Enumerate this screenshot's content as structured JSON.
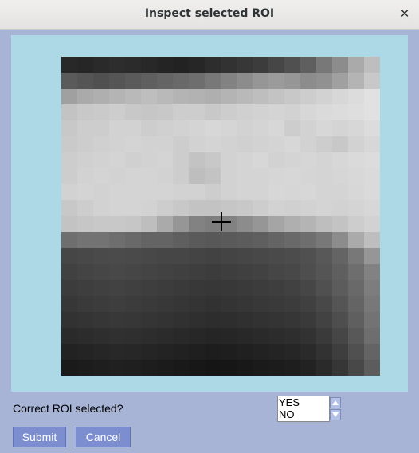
{
  "window": {
    "title": "Inspect selected ROI"
  },
  "close_icon": "close-icon",
  "question": "Correct ROI selected?",
  "options": [
    "YES",
    "NO"
  ],
  "buttons": {
    "submit": "Submit",
    "cancel": "Cancel"
  },
  "colors": {
    "window_bg": "#a7b4d6",
    "panel_bg": "#add8e6",
    "button_bg": "#7c8ecf"
  },
  "roi_image": {
    "grid": [
      20,
      20
    ],
    "gray_rows": [
      [
        40,
        38,
        42,
        45,
        43,
        40,
        36,
        34,
        38,
        45,
        50,
        55,
        60,
        70,
        80,
        95,
        120,
        140,
        170,
        190
      ],
      [
        90,
        85,
        80,
        85,
        90,
        95,
        100,
        105,
        110,
        120,
        130,
        140,
        150,
        155,
        150,
        140,
        145,
        160,
        180,
        200
      ],
      [
        160,
        170,
        175,
        180,
        185,
        190,
        185,
        180,
        178,
        175,
        180,
        185,
        190,
        195,
        200,
        205,
        210,
        215,
        220,
        225
      ],
      [
        195,
        200,
        202,
        205,
        200,
        198,
        200,
        205,
        205,
        200,
        205,
        208,
        210,
        212,
        210,
        215,
        218,
        220,
        222,
        225
      ],
      [
        200,
        205,
        205,
        210,
        210,
        205,
        208,
        210,
        212,
        215,
        213,
        210,
        212,
        215,
        205,
        210,
        215,
        212,
        215,
        220
      ],
      [
        202,
        205,
        208,
        210,
        212,
        210,
        210,
        205,
        210,
        212,
        210,
        208,
        210,
        212,
        215,
        210,
        205,
        200,
        210,
        215
      ],
      [
        205,
        208,
        210,
        212,
        208,
        210,
        212,
        205,
        195,
        200,
        210,
        212,
        215,
        210,
        212,
        214,
        212,
        215,
        218,
        220
      ],
      [
        205,
        210,
        212,
        210,
        212,
        212,
        210,
        205,
        190,
        195,
        210,
        212,
        212,
        214,
        215,
        213,
        212,
        214,
        216,
        218
      ],
      [
        210,
        212,
        210,
        212,
        212,
        212,
        212,
        210,
        210,
        205,
        210,
        212,
        212,
        215,
        214,
        215,
        212,
        212,
        215,
        218
      ],
      [
        200,
        205,
        210,
        212,
        212,
        210,
        205,
        200,
        195,
        195,
        198,
        200,
        205,
        210,
        208,
        210,
        212,
        210,
        212,
        215
      ],
      [
        195,
        198,
        200,
        200,
        198,
        190,
        170,
        150,
        130,
        125,
        130,
        140,
        150,
        165,
        175,
        180,
        190,
        195,
        205,
        210
      ],
      [
        110,
        115,
        115,
        110,
        105,
        100,
        100,
        95,
        90,
        88,
        90,
        92,
        95,
        100,
        105,
        110,
        120,
        140,
        170,
        190
      ],
      [
        70,
        72,
        74,
        75,
        74,
        72,
        70,
        70,
        68,
        66,
        68,
        70,
        72,
        74,
        76,
        80,
        88,
        100,
        120,
        150
      ],
      [
        65,
        68,
        70,
        72,
        70,
        68,
        66,
        64,
        62,
        60,
        62,
        64,
        66,
        70,
        72,
        78,
        85,
        95,
        110,
        130
      ],
      [
        60,
        62,
        64,
        66,
        64,
        62,
        60,
        58,
        56,
        55,
        56,
        58,
        60,
        62,
        65,
        70,
        80,
        92,
        105,
        125
      ],
      [
        55,
        58,
        60,
        62,
        60,
        58,
        56,
        54,
        52,
        50,
        52,
        54,
        56,
        58,
        60,
        64,
        72,
        85,
        100,
        120
      ],
      [
        50,
        52,
        54,
        56,
        55,
        53,
        51,
        49,
        47,
        45,
        46,
        48,
        50,
        52,
        54,
        58,
        66,
        78,
        95,
        115
      ],
      [
        42,
        44,
        46,
        48,
        47,
        45,
        43,
        41,
        39,
        37,
        38,
        40,
        42,
        44,
        46,
        50,
        58,
        70,
        88,
        110
      ],
      [
        34,
        36,
        38,
        40,
        39,
        37,
        35,
        33,
        31,
        29,
        30,
        32,
        34,
        36,
        38,
        42,
        50,
        62,
        80,
        100
      ],
      [
        26,
        28,
        30,
        32,
        31,
        29,
        27,
        25,
        23,
        21,
        22,
        24,
        26,
        28,
        30,
        34,
        42,
        54,
        72,
        92
      ]
    ]
  }
}
